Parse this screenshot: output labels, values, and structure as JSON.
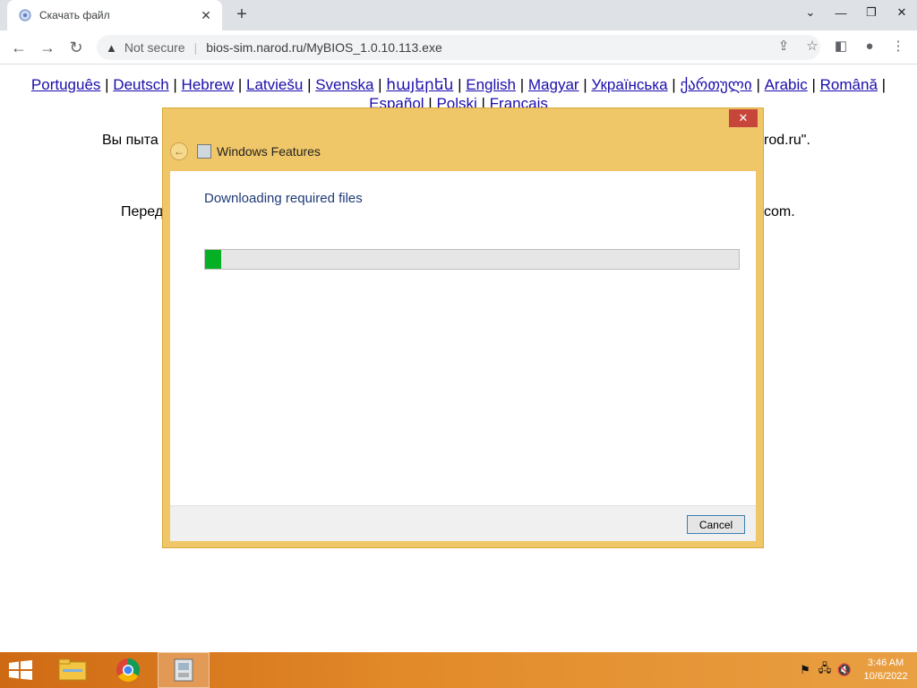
{
  "browser": {
    "tab_title": "Скачать файл",
    "tab_close": "✕",
    "new_tab": "+",
    "security_label": "Not secure",
    "url": "bios-sim.narod.ru/MyBIOS_1.0.10.113.exe"
  },
  "page": {
    "languages": [
      "Português",
      "Deutsch",
      "Hebrew",
      "Latviešu",
      "Svenska",
      "հայերեն",
      "English",
      "Magyar",
      "Українська",
      "ქართული",
      "Arabic",
      "Română",
      "Español",
      "Polski",
      "Francais"
    ],
    "line1_left": "Вы пыта",
    "line1_right": "rod.ru\".",
    "line2_left": "Перед",
    "line2_right": "com."
  },
  "dialog": {
    "close_label": "✕",
    "title": "Windows Features",
    "heading": "Downloading required files",
    "progress_fraction": 0.03,
    "cancel_label": "Cancel"
  },
  "taskbar": {
    "time": "3:46 AM",
    "date": "10/6/2022"
  },
  "colors": {
    "dialog_frame": "#f0c768",
    "progress_fill": "#06b025",
    "link": "#1a0dab"
  }
}
